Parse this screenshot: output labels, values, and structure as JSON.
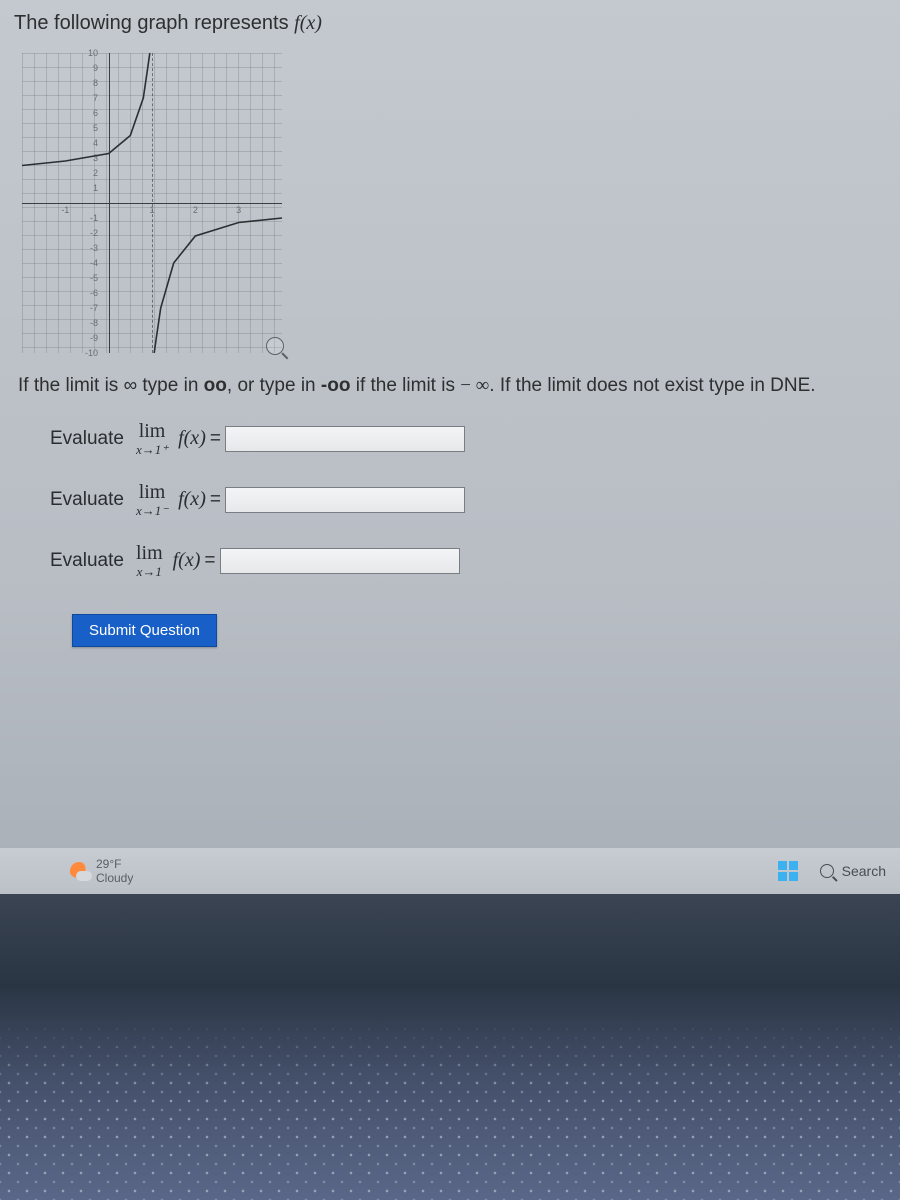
{
  "question": {
    "intro_prefix": "The following graph represents ",
    "intro_fx": "f(x)",
    "instruction_parts": {
      "p1": "If the limit is ∞ type in ",
      "oo": "oo",
      "p2": ", or type in ",
      "neg_oo": "-oo",
      "p3": " if the limit is ",
      "minf": "− ∞",
      "p4": ". If the limit does not exist type in DNE."
    },
    "rows": [
      {
        "evaluate": "Evaluate",
        "lim": "lim",
        "sub": "x→1⁺",
        "fx": "f(x)",
        "eq": "="
      },
      {
        "evaluate": "Evaluate",
        "lim": "lim",
        "sub": "x→1⁻",
        "fx": "f(x)",
        "eq": "="
      },
      {
        "evaluate": "Evaluate",
        "lim": "lim",
        "sub": "x→1",
        "fx": "f(x)",
        "eq": "="
      }
    ],
    "submit": "Submit Question"
  },
  "chart_data": {
    "type": "line",
    "title": "",
    "xlabel": "",
    "ylabel": "",
    "xlim": [
      -2,
      4
    ],
    "ylim": [
      -10,
      10
    ],
    "y_ticks": [
      -10,
      -9,
      -8,
      -7,
      -6,
      -5,
      -4,
      -3,
      -2,
      -1,
      1,
      2,
      3,
      4,
      5,
      6,
      7,
      8,
      9,
      10
    ],
    "x_ticks": [
      -1,
      1,
      2,
      3
    ],
    "vertical_asymptote_x": 1,
    "series": [
      {
        "name": "left-branch",
        "x": [
          -2,
          -1,
          0,
          0.5,
          0.8,
          0.9,
          0.95
        ],
        "values": [
          2.5,
          2.8,
          3.3,
          4.5,
          7,
          9,
          10
        ]
      },
      {
        "name": "right-branch",
        "x": [
          1.05,
          1.1,
          1.2,
          1.5,
          2,
          3,
          4
        ],
        "values": [
          -10,
          -9,
          -7,
          -4,
          -2.2,
          -1.3,
          -1
        ]
      }
    ]
  },
  "taskbar": {
    "weather_temp": "29°F",
    "weather_desc": "Cloudy",
    "search_label": "Search"
  }
}
